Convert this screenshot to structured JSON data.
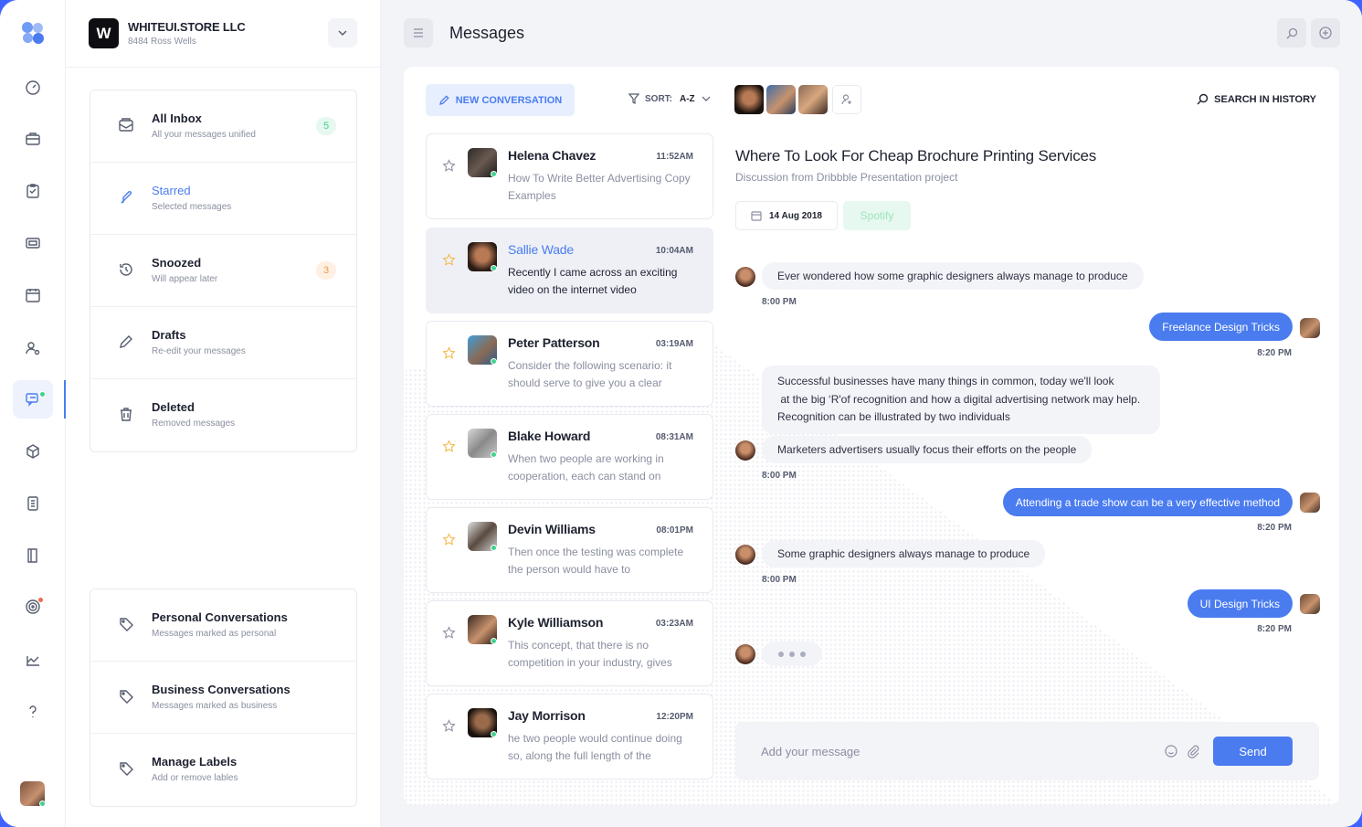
{
  "company": {
    "name": "WHITEUI.STORE LLC",
    "address": "8484 Ross Wells",
    "logo_letter": "W"
  },
  "folders": [
    {
      "label": "All Inbox",
      "desc": "All your messages unified",
      "count": "5",
      "icon": "inbox-icon"
    },
    {
      "label": "Starred",
      "desc": "Selected messages",
      "count": "",
      "icon": "feather-icon"
    },
    {
      "label": "Snoozed",
      "desc": "Will appear later",
      "count": "3",
      "icon": "history-icon"
    },
    {
      "label": "Drafts",
      "desc": "Re-edit your messages",
      "count": "",
      "icon": "pencil-icon"
    },
    {
      "label": "Deleted",
      "desc": "Removed messages",
      "count": "",
      "icon": "trash-icon"
    }
  ],
  "labels": [
    {
      "label": "Personal Conversations",
      "desc": "Messages marked as personal",
      "icon": "tag-icon"
    },
    {
      "label": "Business Conversations",
      "desc": "Messages marked as business",
      "icon": "tag-icon"
    },
    {
      "label": "Manage Labels",
      "desc": "Add or remove lables",
      "icon": "tags-icon"
    }
  ],
  "header": {
    "title": "Messages"
  },
  "toolbar": {
    "new_conversation": "NEW CONVERSATION",
    "sort_label": "SORT:",
    "sort_value": "A-Z",
    "search_history": "SEARCH IN HISTORY"
  },
  "conversations": [
    {
      "name": "Helena Chavez",
      "time": "11:52AM",
      "preview": "How To Write Better Advertising Copy Examples"
    },
    {
      "name": "Sallie Wade",
      "time": "10:04AM",
      "preview": "Recently I came across an exciting video on the internet video"
    },
    {
      "name": "Peter Patterson",
      "time": "03:19AM",
      "preview": "Consider the following scenario: it should serve to give you a clear"
    },
    {
      "name": "Blake Howard",
      "time": "08:31AM",
      "preview": "When two people are working in cooperation, each can stand on"
    },
    {
      "name": "Devin Williams",
      "time": "08:01PM",
      "preview": "Then once the testing was complete the person would have to"
    },
    {
      "name": "Kyle Williamson",
      "time": "03:23AM",
      "preview": "This concept, that there is no competition in your industry, gives"
    },
    {
      "name": "Jay Morrison",
      "time": "12:20PM",
      "preview": "he two people would continue doing so, along the full length of the"
    }
  ],
  "thread": {
    "subject": "Where To Look For Cheap Brochure Printing Services",
    "subtitle": "Discussion from Dribbble Presentation project",
    "date": "14 Aug 2018",
    "tag": "Spotify"
  },
  "messages": {
    "m1": "Ever wondered how some graphic designers always manage to produce",
    "t1": "8:00 PM",
    "m2": "Freelance Design Tricks",
    "t2": "8:20 PM",
    "m3_line1": "Successful businesses have many things in common, today we'll look",
    "m3_line2": " at the big ‘R'of recognition and how a digital advertising network may help.",
    "m3_line3": "Recognition can be illustrated by two individuals",
    "m4": "Marketers advertisers usually focus their efforts on the people",
    "t4": "8:00 PM",
    "m5": "Attending a trade show can be a very effective method",
    "t5": "8:20 PM",
    "m6": "Some graphic designers always manage to produce",
    "t6": "8:00 PM",
    "m7": "UI Design Tricks",
    "t7": "8:20 PM"
  },
  "composer": {
    "placeholder": "Add your message",
    "send": "Send"
  },
  "colors": {
    "accent": "#4a7cf0",
    "green": "#3ed38e",
    "orange": "#f2994a",
    "background": "#f3f4f8"
  }
}
